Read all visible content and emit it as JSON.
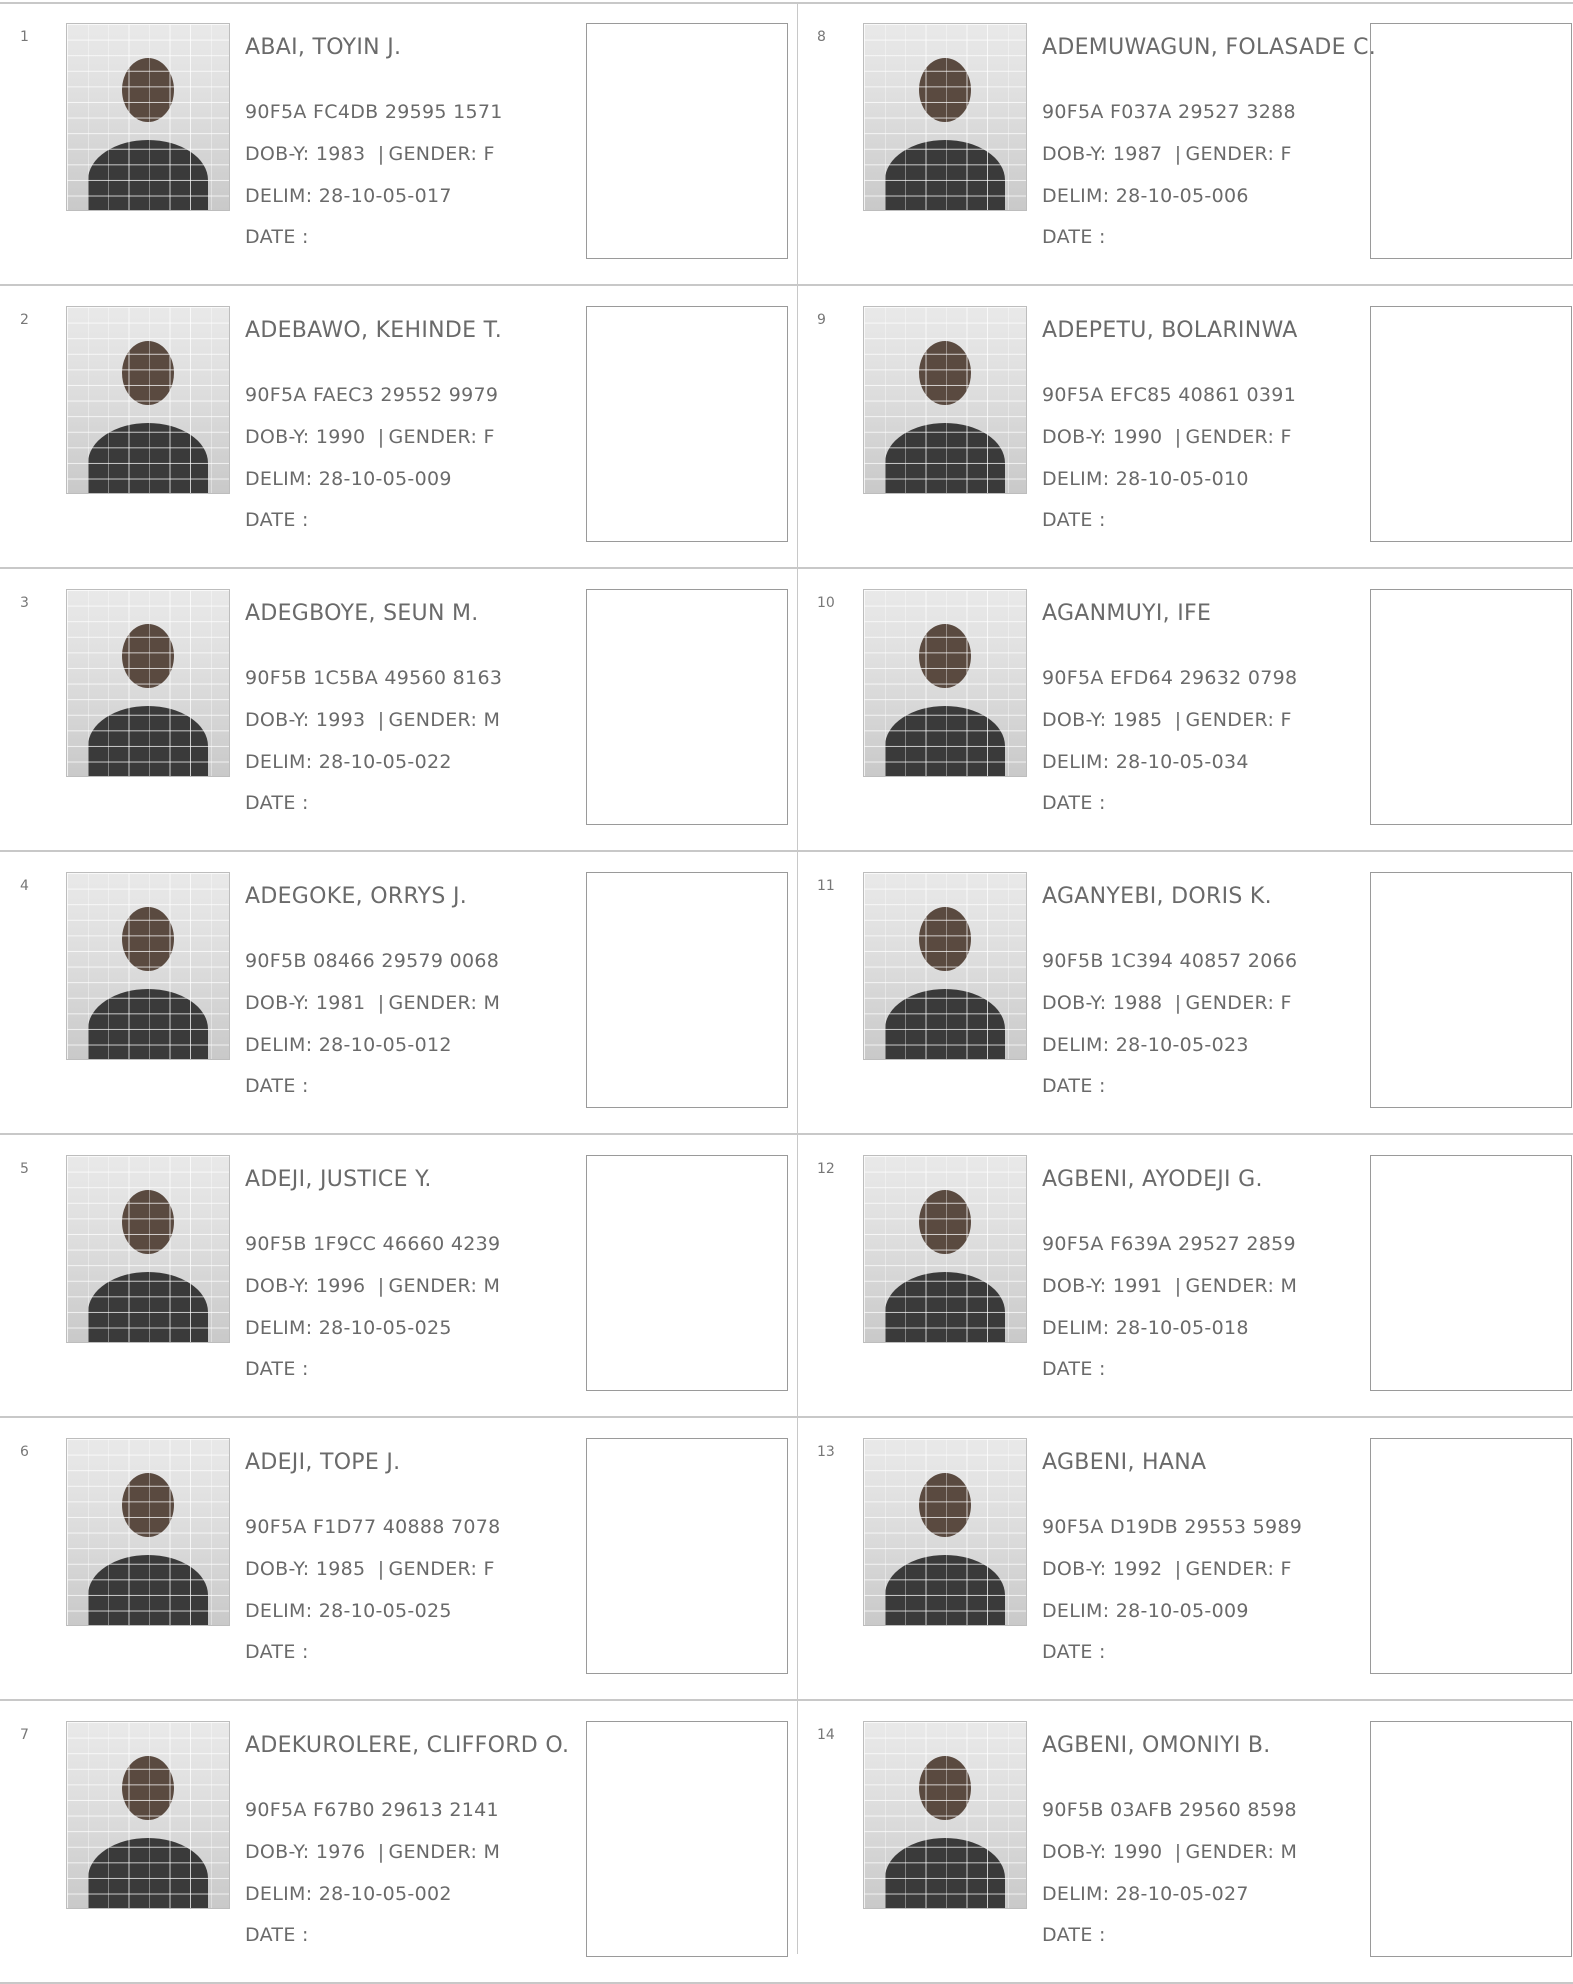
{
  "labels": {
    "dob": "DOB-Y:",
    "gender": "GENDER:",
    "delim": "DELIM:",
    "date": "DATE :",
    "pipe": "|"
  },
  "voters": [
    {
      "num": "1",
      "name": "ABAI, TOYIN J.",
      "vin": "90F5A FC4DB 29595 1571",
      "dob": "1983",
      "gender": "F",
      "delim": "28-10-05-017"
    },
    {
      "num": "2",
      "name": "ADEBAWO, KEHINDE T.",
      "vin": "90F5A FAEC3 29552 9979",
      "dob": "1990",
      "gender": "F",
      "delim": "28-10-05-009"
    },
    {
      "num": "3",
      "name": "ADEGBOYE, SEUN M.",
      "vin": "90F5B 1C5BA 49560 8163",
      "dob": "1993",
      "gender": "M",
      "delim": "28-10-05-022"
    },
    {
      "num": "4",
      "name": "ADEGOKE, ORRYS J.",
      "vin": "90F5B 08466 29579 0068",
      "dob": "1981",
      "gender": "M",
      "delim": "28-10-05-012"
    },
    {
      "num": "5",
      "name": "ADEJI, JUSTICE Y.",
      "vin": "90F5B 1F9CC 46660 4239",
      "dob": "1996",
      "gender": "M",
      "delim": "28-10-05-025"
    },
    {
      "num": "6",
      "name": "ADEJI, TOPE J.",
      "vin": "90F5A F1D77 40888 7078",
      "dob": "1985",
      "gender": "F",
      "delim": "28-10-05-025"
    },
    {
      "num": "7",
      "name": "ADEKUROLERE, CLIFFORD O.",
      "vin": "90F5A F67B0 29613 2141",
      "dob": "1976",
      "gender": "M",
      "delim": "28-10-05-002"
    },
    {
      "num": "8",
      "name": "ADEMUWAGUN, FOLASADE C.",
      "vin": "90F5A F037A 29527 3288",
      "dob": "1987",
      "gender": "F",
      "delim": "28-10-05-006"
    },
    {
      "num": "9",
      "name": "ADEPETU, BOLARINWA",
      "vin": "90F5A EFC85 40861 0391",
      "dob": "1990",
      "gender": "F",
      "delim": "28-10-05-010"
    },
    {
      "num": "10",
      "name": "AGANMUYI, IFE",
      "vin": "90F5A EFD64 29632 0798",
      "dob": "1985",
      "gender": "F",
      "delim": "28-10-05-034"
    },
    {
      "num": "11",
      "name": "AGANYEBI, DORIS K.",
      "vin": "90F5B 1C394 40857 2066",
      "dob": "1988",
      "gender": "F",
      "delim": "28-10-05-023"
    },
    {
      "num": "12",
      "name": "AGBENI, AYODEJI G.",
      "vin": "90F5A F639A 29527 2859",
      "dob": "1991",
      "gender": "M",
      "delim": "28-10-05-018"
    },
    {
      "num": "13",
      "name": "AGBENI, HANA",
      "vin": "90F5A D19DB 29553 5989",
      "dob": "1992",
      "gender": "F",
      "delim": "28-10-05-009"
    },
    {
      "num": "14",
      "name": "AGBENI, OMONIYI B.",
      "vin": "90F5B 03AFB 29560 8598",
      "dob": "1990",
      "gender": "M",
      "delim": "28-10-05-027"
    }
  ]
}
